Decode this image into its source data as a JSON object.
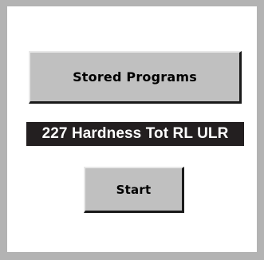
{
  "buttons": {
    "stored_programs": "Stored Programs",
    "start": "Start"
  },
  "program": {
    "name": "227 Hardness Tot RL ULR"
  },
  "colors": {
    "frame": "#b3b3b3",
    "button_face": "#c0c0c0",
    "program_bar": "#231f20",
    "program_text": "#ffffff"
  }
}
